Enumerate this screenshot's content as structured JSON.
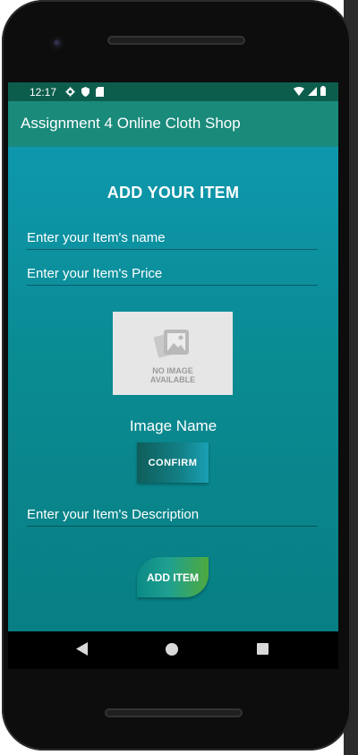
{
  "status_bar": {
    "time": "12:17"
  },
  "app_bar": {
    "title": "Assignment 4 Online Cloth Shop"
  },
  "form": {
    "heading": "ADD YOUR ITEM",
    "name_placeholder": "Enter your Item's name",
    "price_placeholder": "Enter your Item's Price",
    "image_placeholder_label_line1": "NO IMAGE",
    "image_placeholder_label_line2": "AVAILABLE",
    "image_name": "Image Name",
    "confirm_label": "CONFIRM",
    "description_placeholder": "Enter your Item's Description",
    "add_item_label": "ADD ITEM"
  },
  "colors": {
    "status_bar": "#0d5d4d",
    "app_bar": "#1a8a7b",
    "content_top": "#0e97ad",
    "content_bottom": "#087f84"
  }
}
